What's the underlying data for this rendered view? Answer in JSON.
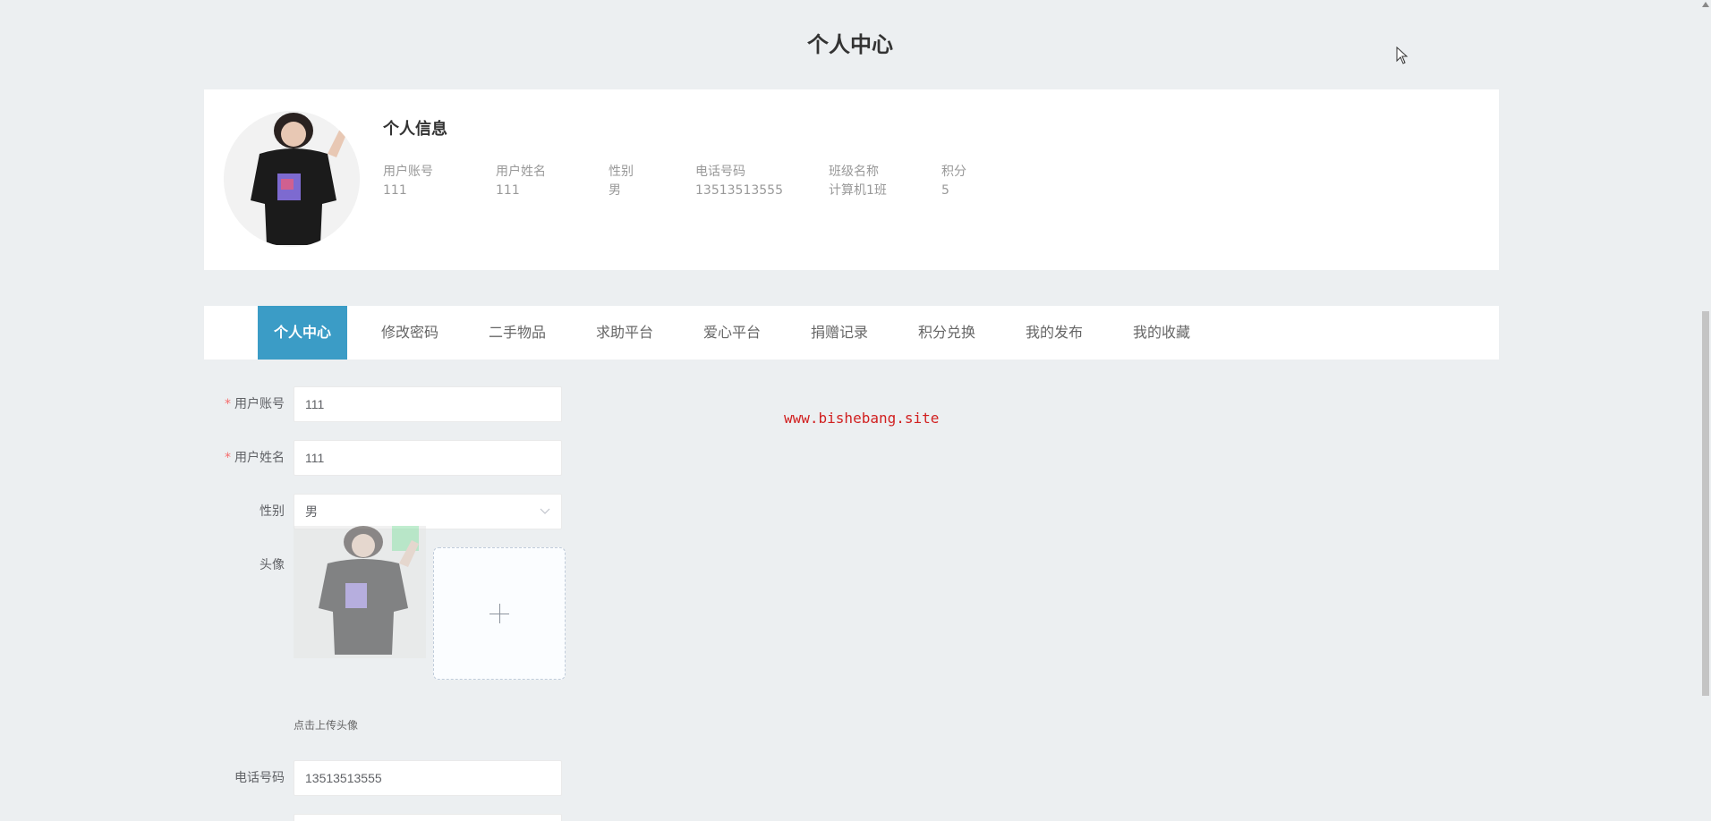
{
  "page": {
    "title": "个人中心"
  },
  "profile": {
    "section_title": "个人信息",
    "fields": [
      {
        "label": "用户账号",
        "value": "111"
      },
      {
        "label": "用户姓名",
        "value": "111"
      },
      {
        "label": "性别",
        "value": "男"
      },
      {
        "label": "电话号码",
        "value": "13513513555"
      },
      {
        "label": "班级名称",
        "value": "计算机1班"
      },
      {
        "label": "积分",
        "value": "5"
      }
    ]
  },
  "tabs": [
    {
      "label": "个人中心",
      "active": true
    },
    {
      "label": "修改密码"
    },
    {
      "label": "二手物品"
    },
    {
      "label": "求助平台"
    },
    {
      "label": "爱心平台"
    },
    {
      "label": "捐赠记录"
    },
    {
      "label": "积分兑换"
    },
    {
      "label": "我的发布"
    },
    {
      "label": "我的收藏"
    }
  ],
  "form": {
    "account": {
      "label": "用户账号",
      "value": "111",
      "required": true
    },
    "name": {
      "label": "用户姓名",
      "value": "111",
      "required": true
    },
    "gender": {
      "label": "性别",
      "value": "男"
    },
    "avatar": {
      "label": "头像",
      "upload_tip": "点击上传头像"
    },
    "phone": {
      "label": "电话号码",
      "value": "13513513555"
    }
  },
  "watermark": "www.bishebang.site",
  "colors": {
    "accent": "#3b9cc6",
    "required": "#f56c6c",
    "watermark": "#d12020",
    "background": "#eceff1"
  }
}
